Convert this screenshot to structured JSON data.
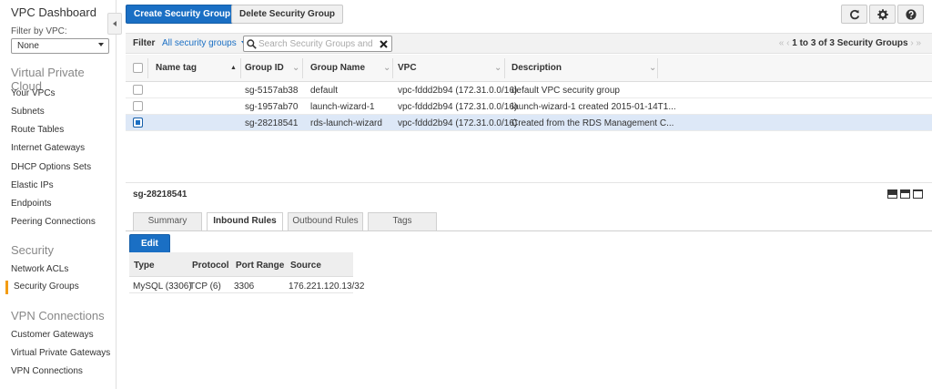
{
  "sidebar": {
    "title": "VPC Dashboard",
    "filter_label": "Filter by VPC:",
    "filter_value": "None",
    "sections": [
      {
        "title": "Virtual Private Cloud",
        "items": [
          "Your VPCs",
          "Subnets",
          "Route Tables",
          "Internet Gateways",
          "DHCP Options Sets",
          "Elastic IPs",
          "Endpoints",
          "Peering Connections"
        ]
      },
      {
        "title": "Security",
        "items": [
          "Network ACLs",
          "Security Groups"
        ]
      },
      {
        "title": "VPN Connections",
        "items": [
          "Customer Gateways",
          "Virtual Private Gateways",
          "VPN Connections"
        ]
      }
    ],
    "active_item": "Security Groups"
  },
  "toolbar": {
    "create_label": "Create Security Group",
    "delete_label": "Delete Security Group",
    "icons": [
      "refresh-icon",
      "gear-icon",
      "help-icon"
    ]
  },
  "filter": {
    "label": "Filter",
    "selector": "All security groups",
    "search_placeholder": "Search Security Groups and their proper",
    "pager_text": "1 to 3 of 3 Security Groups"
  },
  "table": {
    "columns": [
      "Name tag",
      "Group ID",
      "Group Name",
      "VPC",
      "Description"
    ],
    "rows": [
      {
        "name_tag": "",
        "group_id": "sg-5157ab38",
        "group_name": "default",
        "vpc": "vpc-fddd2b94 (172.31.0.0/16)",
        "description": "default VPC security group",
        "selected": false
      },
      {
        "name_tag": "",
        "group_id": "sg-1957ab70",
        "group_name": "launch-wizard-1",
        "vpc": "vpc-fddd2b94 (172.31.0.0/16)",
        "description": "launch-wizard-1 created 2015-01-14T1...",
        "selected": false
      },
      {
        "name_tag": "",
        "group_id": "sg-28218541",
        "group_name": "rds-launch-wizard",
        "vpc": "vpc-fddd2b94 (172.31.0.0/16)",
        "description": "Created from the RDS Management C...",
        "selected": true
      }
    ]
  },
  "detail": {
    "group_id": "sg-28218541",
    "tabs": [
      "Summary",
      "Inbound Rules",
      "Outbound Rules",
      "Tags"
    ],
    "active_tab": "Inbound Rules",
    "edit_label": "Edit",
    "rules_columns": [
      "Type",
      "Protocol",
      "Port Range",
      "Source"
    ],
    "rules": [
      {
        "type": "MySQL (3306)",
        "protocol": "TCP (6)",
        "port_range": "3306",
        "source": "176.221.120.13/32"
      }
    ]
  },
  "colors": {
    "accent": "#1a6fc4",
    "active_marker": "#f39c12",
    "selected_row": "#dde8f7"
  }
}
